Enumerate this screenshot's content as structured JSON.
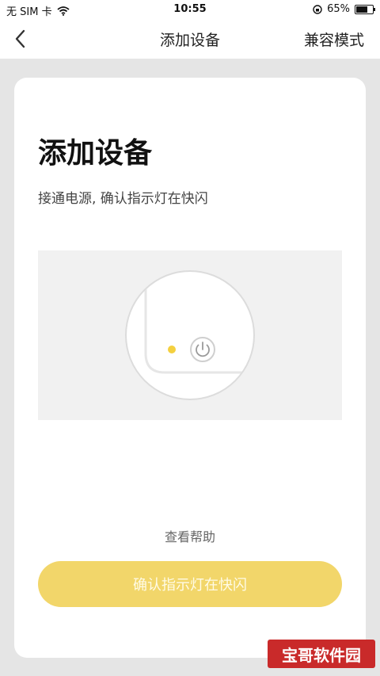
{
  "status_bar": {
    "carrier": "无 SIM 卡",
    "time": "10:55",
    "battery": "65%",
    "battery_level": 0.65
  },
  "nav": {
    "title": "添加设备",
    "compat_mode": "兼容模式"
  },
  "main": {
    "heading": "添加设备",
    "instruction": "接通电源, 确认指示灯在快闪",
    "help_link": "查看帮助",
    "confirm_button": "确认指示灯在快闪"
  },
  "watermark": {
    "text": "宝哥软件园"
  },
  "colors": {
    "accent_button": "#f2d66a",
    "indicator_led": "#f4d03f",
    "watermark_bg": "#c92a2a"
  }
}
